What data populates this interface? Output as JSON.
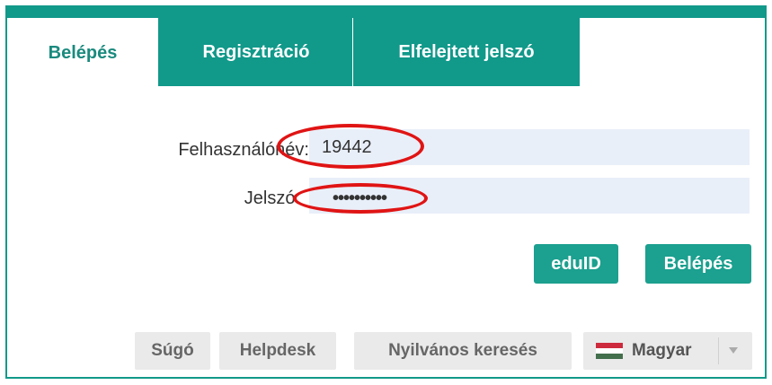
{
  "tabs": [
    {
      "label": "Belépés",
      "active": true
    },
    {
      "label": "Regisztráció",
      "active": false
    },
    {
      "label": "Elfelejtett jelszó",
      "active": false
    }
  ],
  "form": {
    "username_label": "Felhasználónév:",
    "username_value": "19442",
    "password_label": "Jelszó:",
    "password_mask": "••••••••••"
  },
  "actions": {
    "eduid_label": "eduID",
    "login_label": "Belépés"
  },
  "footer": {
    "help_label": "Súgó",
    "helpdesk_label": "Helpdesk",
    "public_search_label": "Nyilvános keresés",
    "language_label": "Magyar"
  },
  "colors": {
    "accent": "#11998a",
    "button": "#1ca08f",
    "annotation": "#e01414",
    "flag": [
      "#cd2a3e",
      "#ffffff",
      "#436f4d"
    ]
  }
}
